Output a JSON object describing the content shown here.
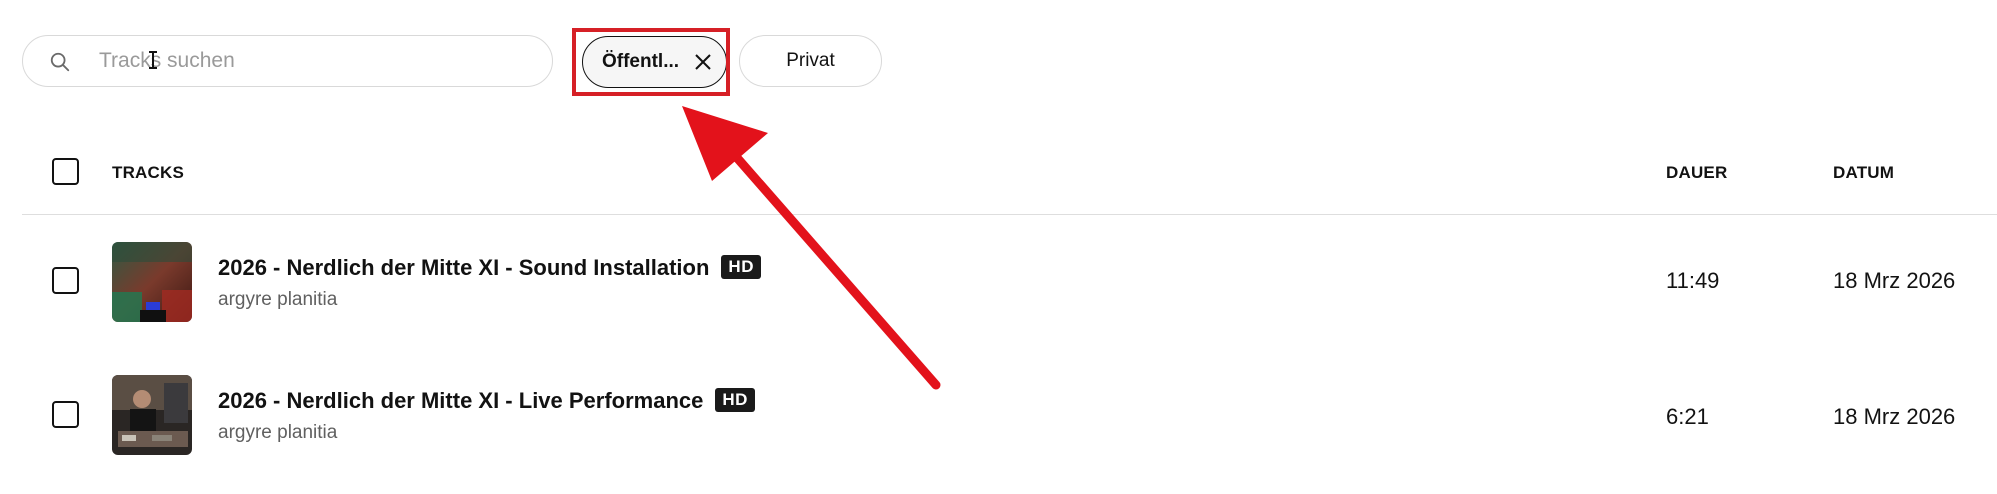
{
  "search": {
    "placeholder": "Tracks suchen"
  },
  "filters": {
    "public_label": "Öffentl...",
    "private_label": "Privat"
  },
  "table": {
    "columns": {
      "tracks": "TRACKS",
      "duration": "DAUER",
      "date": "DATUM"
    },
    "rows": [
      {
        "title": "2026 - Nerdlich der Mitte XI - Sound Installation",
        "badge": "HD",
        "artist": "argyre planitia",
        "duration": "11:49",
        "date": "18 Mrz 2026"
      },
      {
        "title": "2026 - Nerdlich der Mitte XI - Live Performance",
        "badge": "HD",
        "artist": "argyre planitia",
        "duration": "6:21",
        "date": "18 Mrz 2026"
      }
    ]
  },
  "colors": {
    "annotation": "#e3121b",
    "text": "#121212",
    "muted": "#606060"
  }
}
